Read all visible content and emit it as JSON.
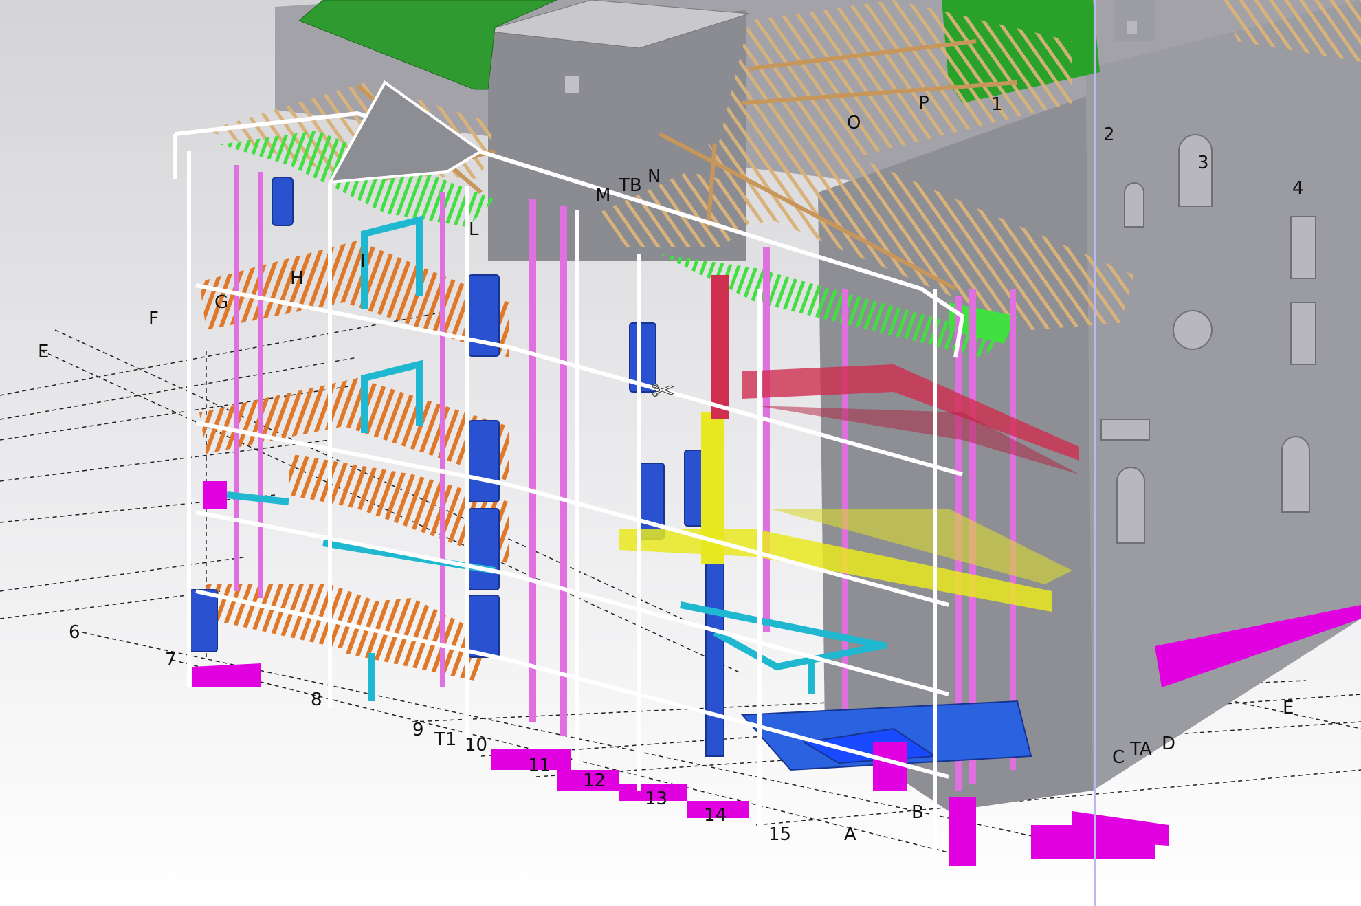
{
  "viewer": {
    "background_top": "#dcdcdc",
    "background_bottom": "#ffffff",
    "section_plane_color": "#b9b9f0"
  },
  "colors": {
    "masonry": "#9a9aa0",
    "masonry_dark": "#7d7d84",
    "roof_green": "#2f9a2f",
    "timber": "#d8b27a",
    "floor_joists": "#e0782a",
    "slab_outline": "#ffffff",
    "vent_purple": "#e070e0",
    "footing_magenta": "#e000e0",
    "duct_cyan": "#20b8d0",
    "tank_blue": "#2a52d0",
    "yellow_tray": "#e8e820",
    "red_pipe": "#d03050",
    "green_tray": "#40e040",
    "grid_line": "#222222"
  },
  "grid_labels": [
    {
      "id": "E-left",
      "text": "E"
    },
    {
      "id": "F",
      "text": "F"
    },
    {
      "id": "G",
      "text": "G"
    },
    {
      "id": "H",
      "text": "H"
    },
    {
      "id": "I",
      "text": "I"
    },
    {
      "id": "L",
      "text": "L"
    },
    {
      "id": "M",
      "text": "M"
    },
    {
      "id": "TB",
      "text": "TB"
    },
    {
      "id": "N",
      "text": "N"
    },
    {
      "id": "O",
      "text": "O"
    },
    {
      "id": "P",
      "text": "P"
    },
    {
      "id": "1",
      "text": "1"
    },
    {
      "id": "2",
      "text": "2"
    },
    {
      "id": "3",
      "text": "3"
    },
    {
      "id": "4",
      "text": "4"
    },
    {
      "id": "6",
      "text": "6"
    },
    {
      "id": "7",
      "text": "7"
    },
    {
      "id": "8",
      "text": "8"
    },
    {
      "id": "9",
      "text": "9"
    },
    {
      "id": "T1",
      "text": "T1"
    },
    {
      "id": "10",
      "text": "10"
    },
    {
      "id": "11",
      "text": "11"
    },
    {
      "id": "12",
      "text": "12"
    },
    {
      "id": "13",
      "text": "13"
    },
    {
      "id": "14",
      "text": "14"
    },
    {
      "id": "15",
      "text": "15"
    },
    {
      "id": "A",
      "text": "A"
    },
    {
      "id": "B",
      "text": "B"
    },
    {
      "id": "C",
      "text": "C"
    },
    {
      "id": "TA",
      "text": "TA"
    },
    {
      "id": "D",
      "text": "D"
    },
    {
      "id": "E-right",
      "text": "E"
    }
  ]
}
